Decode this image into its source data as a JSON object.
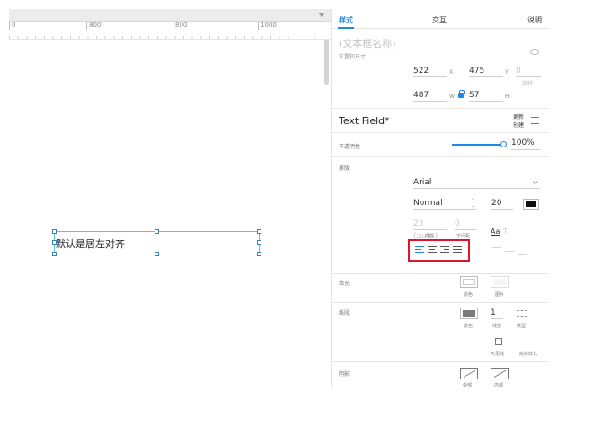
{
  "canvas": {
    "ruler_marks": [
      "0",
      "800",
      "800",
      "1000"
    ],
    "textfield_text": "默认是居左对齐"
  },
  "inspector": {
    "tabs": [
      "样式",
      "交互",
      "说明"
    ],
    "widget_name_placeholder": "(文本框名称)",
    "position_size_label": "位置和尺寸",
    "position": {
      "x": "522",
      "y": "475",
      "x_unit": "X",
      "y_unit": "Y",
      "rotation": "0",
      "rotation_label": "旋转"
    },
    "size": {
      "w": "487",
      "h": "57",
      "w_unit": "W",
      "h_unit": "H"
    },
    "style_name": "Text Field*",
    "update_style_label": "更新\n创建",
    "opacity_label": "不透明性",
    "opacity_value": "100%",
    "typography_label": "排版",
    "font_family": "Arial",
    "font_weight": "Normal",
    "font_size": "20",
    "line_height": "23 (auto)",
    "line_height_label": "线段",
    "char_spacing": "0",
    "char_spacing_label": "字间距",
    "aa_label": "Aa",
    "t_label": "T",
    "fill_label": "填充",
    "fill_color_label": "颜色",
    "fill_image_label": "图片",
    "border_label": "线段",
    "border_color_label": "颜色",
    "border_width": "1",
    "border_width_label": "线宽",
    "border_type_label": "类型",
    "visible_borders_label": "可见线",
    "arrow_style_label": "箭头样式",
    "shadow_label": "阴影",
    "shadow_outer_label": "外部",
    "shadow_inner_label": "内部",
    "colors": {
      "accent": "#1e88e5",
      "highlight_box": "#e0142a",
      "selection": "#5cc8c8",
      "font_color": "#111111",
      "border_color": "#7a7a7a"
    }
  }
}
